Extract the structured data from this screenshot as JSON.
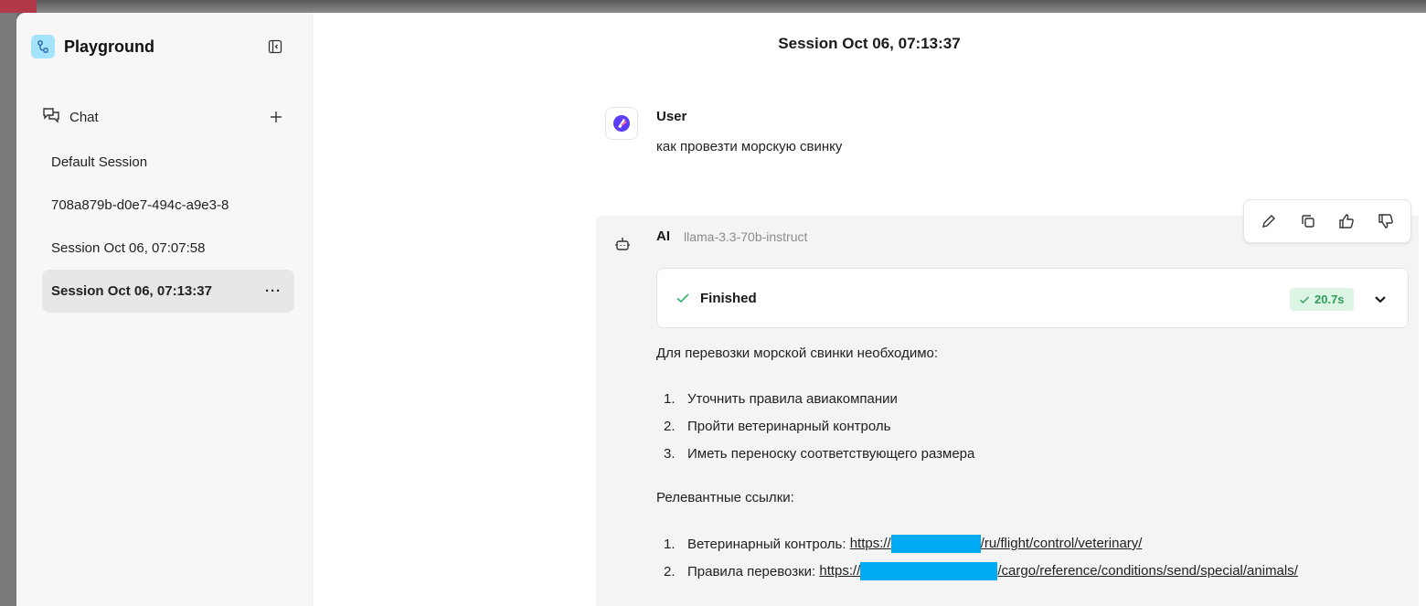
{
  "sidebar": {
    "brand_title": "Playground",
    "chat_label": "Chat",
    "sessions": [
      {
        "label": "Default Session"
      },
      {
        "label": "708a879b-d0e7-494c-a9e3-8"
      },
      {
        "label": "Session Oct 06, 07:07:58"
      },
      {
        "label": "Session Oct 06, 07:13:37",
        "active": true,
        "more": "···"
      }
    ]
  },
  "header": {
    "title": "Session Oct 06, 07:13:37"
  },
  "user_message": {
    "author": "User",
    "text": "как провезти морскую свинку"
  },
  "ai_message": {
    "author": "AI",
    "model": "llama-3.3-70b-instruct",
    "status": "Finished",
    "duration": "20.7s",
    "intro": "Для перевозки морской свинки необходимо:",
    "steps": [
      {
        "num": "1.",
        "text": "Уточнить правила авиакомпании"
      },
      {
        "num": "2.",
        "text": "Пройти ветеринарный контроль"
      },
      {
        "num": "3.",
        "text": "Иметь переноску соответствующего размера"
      }
    ],
    "links_heading": "Релевантные ссылки:",
    "links": [
      {
        "num": "1.",
        "label": "Ветеринарный контроль: ",
        "prefix": "https://",
        "suffix": "/ru/flight/control/veterinary/"
      },
      {
        "num": "2.",
        "label": "Правила перевозки: ",
        "prefix": "https://",
        "suffix": "/cargo/reference/conditions/send/special/animals/"
      }
    ]
  },
  "colors": {
    "accent_badge_bg": "#dcf5e4",
    "accent_badge_text": "#2e9e58",
    "redaction": "#00a9f4",
    "brand_logo_bg": "#a5e3fa"
  },
  "icons": [
    "workflow-icon",
    "sidebar-collapse-icon",
    "chat-icon",
    "plus-icon",
    "more-icon",
    "avatar-icon",
    "bot-icon",
    "edit-icon",
    "copy-icon",
    "thumbs-up-icon",
    "thumbs-down-icon",
    "check-icon",
    "chevron-down-icon"
  ]
}
